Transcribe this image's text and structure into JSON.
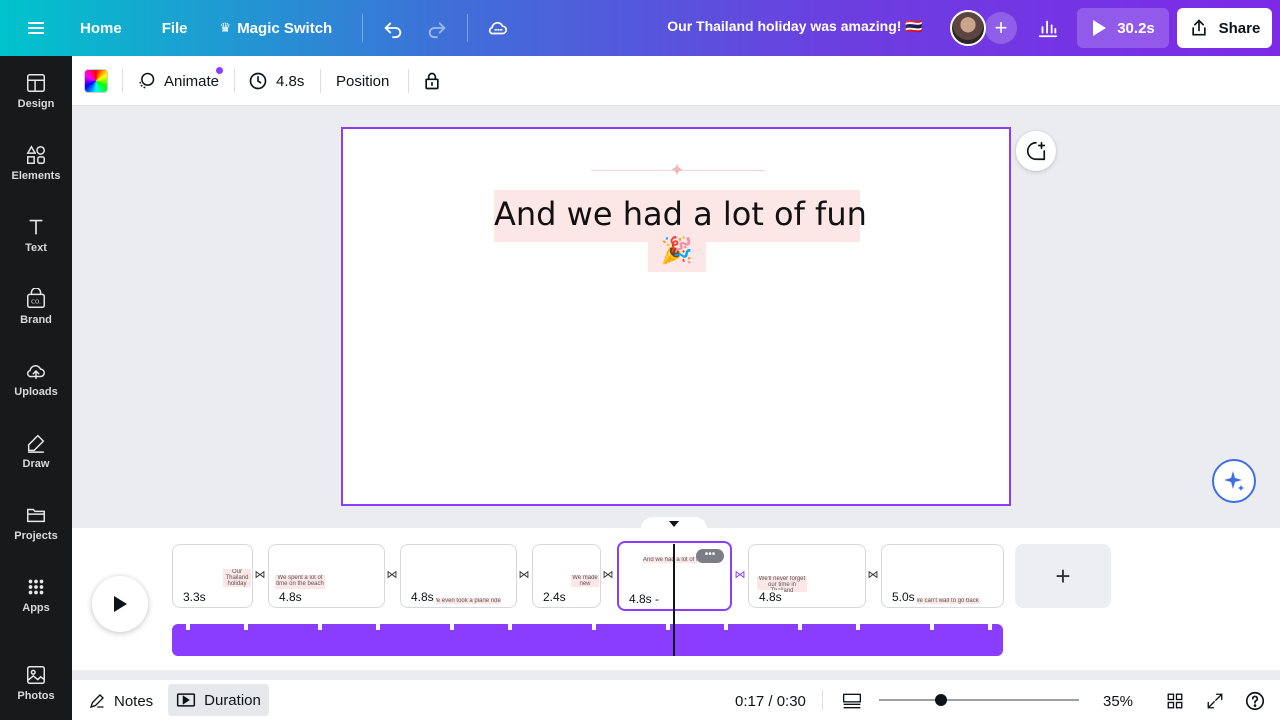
{
  "topbar": {
    "home_label": "Home",
    "file_label": "File",
    "magic_switch_label": "Magic Switch",
    "doc_title": "Our Thailand holiday was amazing! 🇹🇭",
    "play_duration": "30.2s",
    "share_label": "Share"
  },
  "sidebar": {
    "items": [
      {
        "label": "Design",
        "icon": "design-icon"
      },
      {
        "label": "Elements",
        "icon": "elements-icon"
      },
      {
        "label": "Text",
        "icon": "text-icon"
      },
      {
        "label": "Brand",
        "icon": "brand-icon"
      },
      {
        "label": "Uploads",
        "icon": "uploads-icon"
      },
      {
        "label": "Draw",
        "icon": "draw-icon"
      },
      {
        "label": "Projects",
        "icon": "projects-icon"
      },
      {
        "label": "Apps",
        "icon": "apps-icon"
      },
      {
        "label": "Photos",
        "icon": "photos-icon"
      }
    ]
  },
  "context_toolbar": {
    "animate_label": "Animate",
    "duration_label": "4.8s",
    "position_label": "Position"
  },
  "canvas": {
    "headline": "And we had a lot of fun",
    "emoji": "🎉"
  },
  "timeline": {
    "pages": [
      {
        "duration": "3.3s",
        "thumb_text": "Our Thailand holiday was amazing!"
      },
      {
        "duration": "4.8s",
        "thumb_text": "We spent a lot of time on the beach"
      },
      {
        "duration": "4.8s",
        "thumb_text": "We even took a plane ride"
      },
      {
        "duration": "2.4s",
        "thumb_text": "We made new friends"
      },
      {
        "duration": "4.8s -",
        "thumb_text": "And we had a lot of fun"
      },
      {
        "duration": "4.8s",
        "thumb_text": "We'll never forget our time in Thailand"
      },
      {
        "duration": "5.0s",
        "thumb_text": "We can't wait to go back soon"
      }
    ],
    "more_label": "•••",
    "add_page_label": "+"
  },
  "bottombar": {
    "notes_label": "Notes",
    "duration_label": "Duration",
    "time_display": "0:17 / 0:30",
    "zoom": "35%",
    "zoom_fraction": 0.31
  },
  "colors": {
    "accent": "#8b3dff",
    "highlight": "#fde6e6",
    "rail_bg": "#18191b"
  }
}
